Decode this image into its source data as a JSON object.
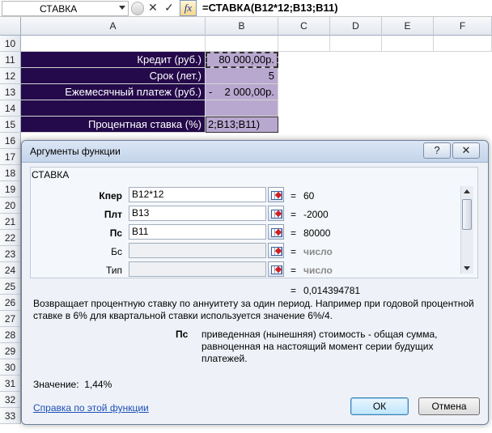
{
  "formula_bar": {
    "name_box": "СТАВКА",
    "cancel_glyph": "✕",
    "enter_glyph": "✓",
    "fx_glyph": "fx",
    "formula": "=СТАВКА(B12*12;B13;B11)"
  },
  "columns": [
    "A",
    "B",
    "C",
    "D",
    "E",
    "F"
  ],
  "rows": [
    "10",
    "11",
    "12",
    "13",
    "14",
    "15",
    "16",
    "17",
    "18",
    "19",
    "20",
    "21",
    "22",
    "23",
    "24",
    "25",
    "26",
    "27",
    "28",
    "29",
    "30",
    "31",
    "32",
    "33"
  ],
  "cells": {
    "a11": "Кредит (руб.)",
    "b11": "80 000,00р.",
    "a12": "Срок (лет.)",
    "b12": "5",
    "a13": "Ежемесячный платеж (руб.)",
    "b13_sign": "-",
    "b13": "2 000,00р.",
    "a15": "Процентная ставка (%)",
    "b15": "2;B13;B11)"
  },
  "colors": {
    "label_fill": "#240a4a",
    "value_fill": "#b8a8d0",
    "link": "#1d4fb8"
  },
  "dialog": {
    "title": "Аргументы функции",
    "help_glyph": "?",
    "close_glyph": "✕",
    "function_name": "СТАВКА",
    "args": [
      {
        "label": "Кпер",
        "value": "B12*12",
        "eq": "=",
        "result": "60"
      },
      {
        "label": "Плт",
        "value": "B13",
        "eq": "=",
        "result": "-2000"
      },
      {
        "label": "Пс",
        "value": "B11",
        "eq": "=",
        "result": "80000"
      },
      {
        "label": "Бс",
        "value": "",
        "eq": "=",
        "result": "число"
      },
      {
        "label": "Тип",
        "value": "",
        "eq": "=",
        "result": "число"
      }
    ],
    "result_eq": "=",
    "result": "0,014394781",
    "description": "Возвращает процентную ставку по аннуитету за один период. Например при годовой процентной ставке в 6% для квартальной ставки используется значение 6%/4.",
    "arg_desc_name": "Пс",
    "arg_desc_text": "приведенная (нынешняя) стоимость - общая сумма, равноценная на настоящий момент серии будущих платежей.",
    "value_label": "Значение:",
    "value": "1,44%",
    "help_link": "Справка по этой функции",
    "ok": "ОК",
    "cancel": "Отмена"
  }
}
